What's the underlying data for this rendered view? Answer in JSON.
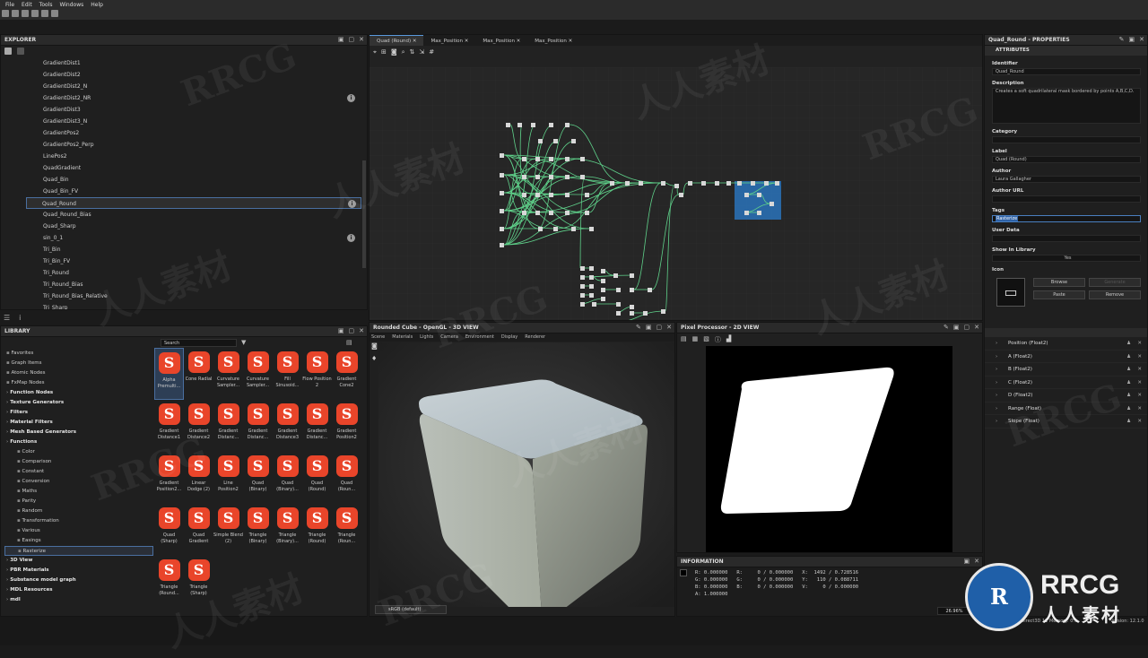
{
  "menu": [
    "File",
    "Edit",
    "Tools",
    "Windows",
    "Help"
  ],
  "explorer": {
    "title": "EXPLORER",
    "items": [
      "GradientDist1",
      "GradientDist2",
      "GradientDist2_N",
      "GradientDist2_NR",
      "GradientDist3",
      "GradientDist3_N",
      "GradientPos2",
      "GradientPos2_Perp",
      "LinePos2",
      "QuadGradient",
      "Quad_Bin",
      "Quad_Bin_FV",
      "Quad_Round",
      "Quad_Round_Bias",
      "Quad_Sharp",
      "sin_0_1",
      "Tri_Bin",
      "Tri_Bin_FV",
      "Tri_Round",
      "Tri_Round_Bias",
      "Tri_Round_Bias_Relative",
      "Tri_Sharp"
    ],
    "selected": "Quad_Round"
  },
  "library": {
    "title": "LIBRARY",
    "search_placeholder": "Search",
    "categories": [
      {
        "label": "Favorites",
        "bold": false,
        "indent": 0
      },
      {
        "label": "Graph Items",
        "bold": false,
        "indent": 0
      },
      {
        "label": "Atomic Nodes",
        "bold": false,
        "indent": 0
      },
      {
        "label": "FxMap Nodes",
        "bold": false,
        "indent": 0
      },
      {
        "label": "Function Nodes",
        "bold": true,
        "indent": 0
      },
      {
        "label": "Texture Generators",
        "bold": true,
        "indent": 0
      },
      {
        "label": "Filters",
        "bold": true,
        "indent": 0
      },
      {
        "label": "Material Filters",
        "bold": true,
        "indent": 0
      },
      {
        "label": "Mesh Based Generators",
        "bold": true,
        "indent": 0
      },
      {
        "label": "Functions",
        "bold": true,
        "indent": 0
      },
      {
        "label": "Color",
        "bold": false,
        "indent": 1
      },
      {
        "label": "Comparison",
        "bold": false,
        "indent": 1
      },
      {
        "label": "Constant",
        "bold": false,
        "indent": 1
      },
      {
        "label": "Conversion",
        "bold": false,
        "indent": 1
      },
      {
        "label": "Maths",
        "bold": false,
        "indent": 1
      },
      {
        "label": "Parity",
        "bold": false,
        "indent": 1
      },
      {
        "label": "Random",
        "bold": false,
        "indent": 1
      },
      {
        "label": "Transformation",
        "bold": false,
        "indent": 1
      },
      {
        "label": "Various",
        "bold": false,
        "indent": 1
      },
      {
        "label": "Easings",
        "bold": false,
        "indent": 1
      },
      {
        "label": "Rasterize",
        "bold": false,
        "indent": 1
      },
      {
        "label": "3D View",
        "bold": true,
        "indent": 0
      },
      {
        "label": "PBR Materials",
        "bold": true,
        "indent": 0
      },
      {
        "label": "Substance model graph",
        "bold": true,
        "indent": 0
      },
      {
        "label": "MDL Resources",
        "bold": true,
        "indent": 0
      },
      {
        "label": "mdl",
        "bold": true,
        "indent": 0
      }
    ],
    "selected_category": "Rasterize",
    "nodes": [
      "Alpha Premulti...",
      "Cone Radial",
      "Curvature Sampler...",
      "Curvature Sampler...",
      "Fill Sinusoid...",
      "Flow Position 2",
      "Gradient Cone2",
      "Gradient Distance1",
      "Gradient Distance2",
      "Gradient Distanc...",
      "Gradient Distanc...",
      "Gradient Distance3",
      "Gradient Distanc...",
      "Gradient Position2",
      "Gradient Position2...",
      "Linear Dodge (2)",
      "Line Position2",
      "Quad (Binary)",
      "Quad (Binary)...",
      "Quad (Round)",
      "Quad (Roun...",
      "Quad (Sharp)",
      "Quad Gradient",
      "Simple Blend (2)",
      "Triangle (Binary)",
      "Triangle (Binary)...",
      "Triangle (Round)",
      "Triangle (Roun...",
      "Triangle (Round...",
      "Triangle (Sharp)"
    ]
  },
  "graph": {
    "tabs": [
      "Quad (Round)",
      "Max_Position",
      "Max_Position",
      "Max_Position"
    ]
  },
  "view3d": {
    "title": "Rounded Cube - OpenGL - 3D VIEW",
    "menu": [
      "Scene",
      "Materials",
      "Lights",
      "Camera",
      "Environment",
      "Display",
      "Renderer"
    ],
    "colorspace": "sRGB (default)"
  },
  "view2d": {
    "title": "Pixel Processor - 2D VIEW",
    "zoom": "26.96%"
  },
  "information": {
    "title": "INFORMATION",
    "lines": [
      "R: 0.000000   R:     0 / 0.000000   X:  1492 / 0.728516",
      "G: 0.000000   G:     0 / 0.000000   Y:   110 / 0.088711",
      "B: 0.000000   B:     0 / 0.000000   V:     0 / 0.000000",
      "A: 1.000000"
    ]
  },
  "properties": {
    "title": "Quad_Round - PROPERTIES",
    "section": "ATTRIBUTES",
    "identifier_label": "Identifier",
    "identifier": "Quad_Round",
    "description_label": "Description",
    "description": "Creates a soft quadrilateral mask bordered by points A,B,C,D.",
    "category_label": "Category",
    "label_label": "Label",
    "label": "Quad (Round)",
    "author_label": "Author",
    "author": "Laura Gallagher",
    "author_url_label": "Author URL",
    "tags_label": "Tags",
    "tags": "Rasterize",
    "user_data_label": "User Data",
    "show_in_library_label": "Show In Library",
    "show_in_library": "Yes",
    "icon_label": "Icon",
    "buttons": {
      "browse": "Browse",
      "generate": "Generate",
      "paste": "Paste",
      "remove": "Remove"
    },
    "params": [
      "Position (Float2)",
      "A (Float2)",
      "B (Float2)",
      "C (Float2)",
      "D (Float2)",
      "Range (Float)",
      "Slope (Float)"
    ]
  },
  "status": {
    "engine": "Engine: Direct3D 11  Memory: 0%",
    "version": "Version: 12.1.0"
  },
  "watermarks": {
    "brand": "RRCG",
    "cn": "人人素材"
  }
}
